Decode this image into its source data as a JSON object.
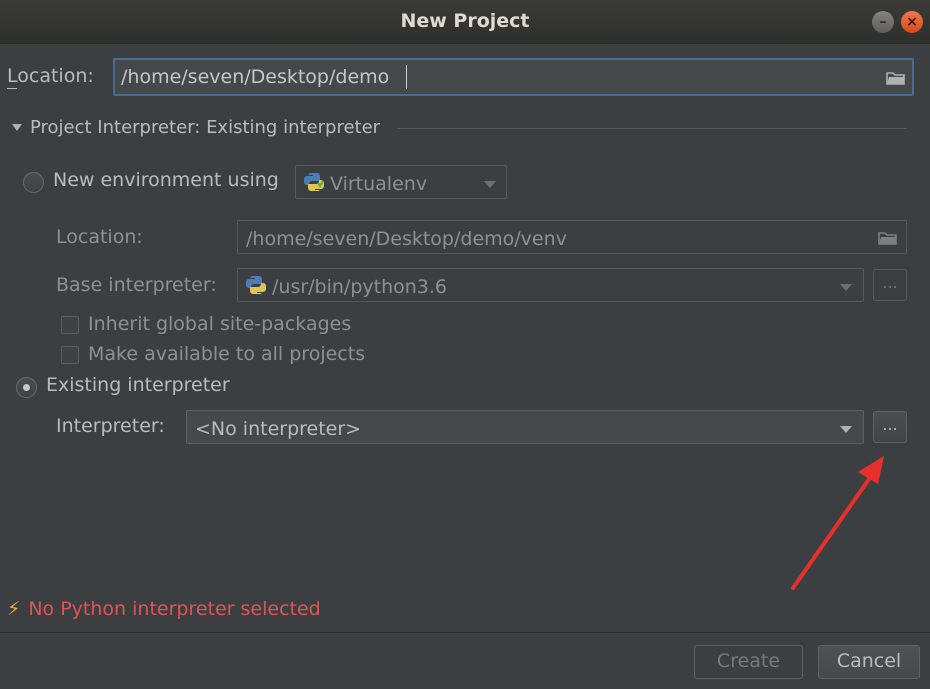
{
  "window": {
    "title": "New Project"
  },
  "location": {
    "label": "Location:",
    "value": "/home/seven/Desktop/demo"
  },
  "interpreter_section": {
    "header": "Project Interpreter: Existing interpreter"
  },
  "new_env": {
    "radio_label": "New environment using",
    "tool_value": "Virtualenv",
    "location_label": "Location:",
    "location_value": "/home/seven/Desktop/demo/venv",
    "base_label": "Base interpreter:",
    "base_value": "/usr/bin/python3.6",
    "base_browse": "...",
    "inherit_label": "Inherit global site-packages",
    "available_label": "Make available to all projects"
  },
  "existing": {
    "radio_label": "Existing interpreter",
    "interpreter_label": "Interpreter:",
    "interpreter_value": "<No interpreter>",
    "browse": "..."
  },
  "error": {
    "message": "No Python interpreter selected"
  },
  "buttons": {
    "create": "Create",
    "cancel": "Cancel"
  },
  "colors": {
    "background": "#3c3f41",
    "accent_border": "#466d94",
    "error": "#e05454",
    "annotation_arrow": "#e8302b"
  }
}
